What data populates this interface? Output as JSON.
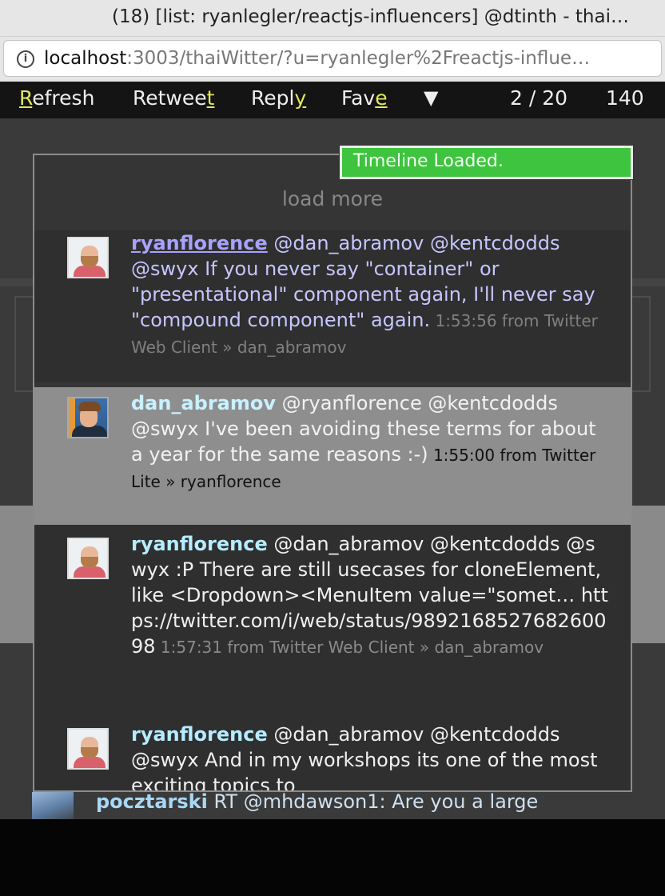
{
  "window": {
    "title": "(18) [list: ryanlegler/reactjs-influencers] @dtinth - thai…",
    "url_host": "localhost",
    "url_rest": ":3003/thaiWitter/?u=ryanlegler%2Freactjs-influe…"
  },
  "toolbar": {
    "refresh": {
      "key": "R",
      "rest": "efresh"
    },
    "retweet": {
      "pre": "Retwee",
      "key": "t"
    },
    "reply": {
      "pre": "Repl",
      "key": "y"
    },
    "fave": {
      "pre": "Fav",
      "key": "e"
    },
    "menu_glyph": "▼",
    "position": "2 / 20",
    "chars": "140"
  },
  "toast": "Timeline Loaded.",
  "timeline": {
    "load_more": "load more",
    "tweets": [
      {
        "user": "ryanflorence",
        "text": " @dan_abramov @kentcdodds @swyx If you never say \"container\" or \"presentational\" component again, I'll never say \"compound component\" again.",
        "meta": " 1:53:56 from Twitter Web Client » dan_abramov",
        "avatar": "ryanflorence-avatar"
      },
      {
        "user": "dan_abramov",
        "text": " @ryanflorence @kentcdodds @swyx I've been avoiding these terms for about a year for the same reasons :-)",
        "meta": " 1:55:00 from Twitter Lite » ryanflorence",
        "avatar": "dan-abramov-avatar"
      },
      {
        "user": "ryanflorence",
        "text": " @dan_abramov @kentcdodds @swyx :P There are still usecases for cloneElement, like <Dropdown><MenuItem value=\"somet… https://twitter.com/i/web/status/989216852768260098",
        "meta": " 1:57:31 from Twitter Web Client » dan_abramov",
        "avatar": "ryanflorence-avatar"
      },
      {
        "user": "ryanflorence",
        "text": " @dan_abramov @kentcdodds @swyx And in my workshops its one of the most exciting topics to",
        "meta": "",
        "avatar": "ryanflorence-avatar"
      }
    ]
  },
  "behind": {
    "user": "pocztarski",
    "text": " RT @mhdawson1: Are you a large"
  },
  "colors": {
    "toolbar_key": "#e3e85c",
    "toast_bg": "#3ec43e",
    "link_user": "#a8a2ff"
  }
}
